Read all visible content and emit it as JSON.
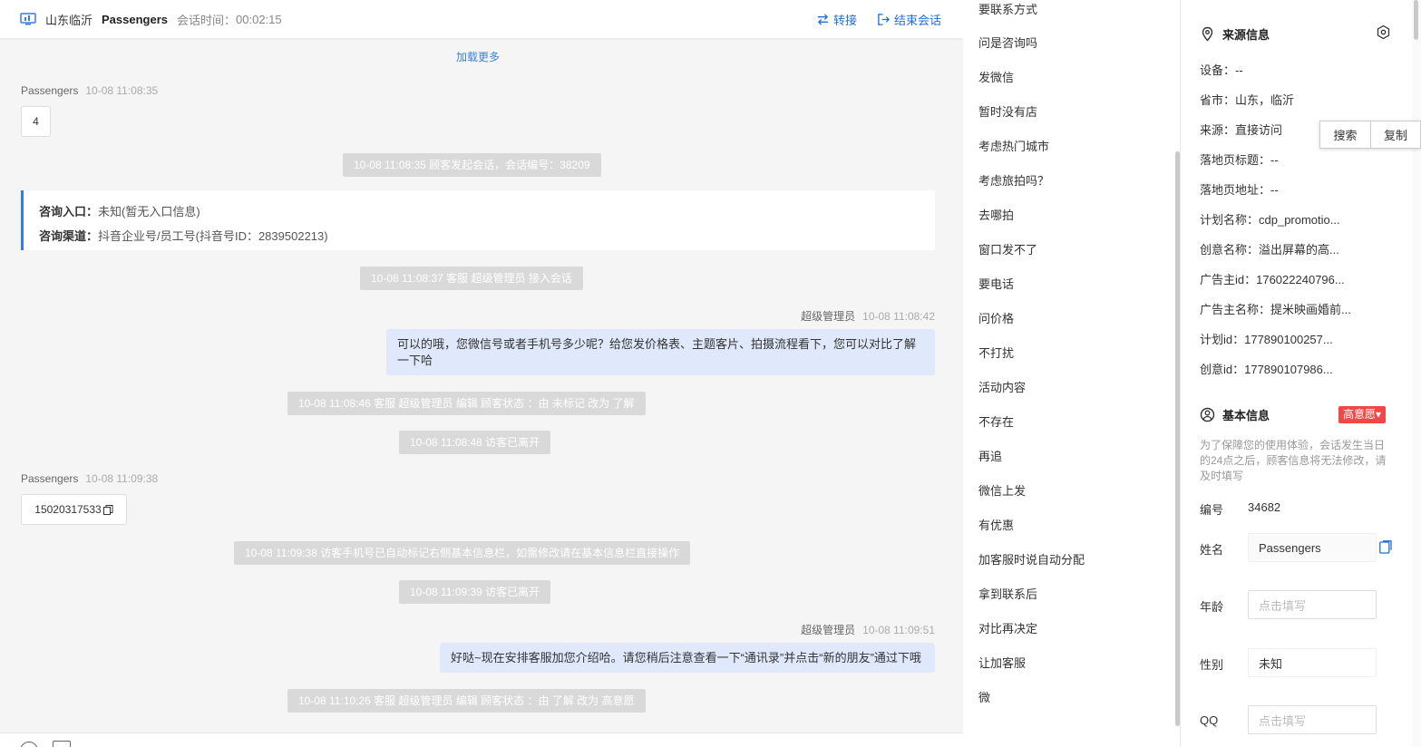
{
  "header": {
    "location": "山东临沂",
    "visitor_name": "Passengers",
    "session_time_label": "会话时间：",
    "session_time": "00:02:15",
    "transfer_label": "转接",
    "end_label": "结束会话"
  },
  "chat": {
    "load_more": "加载更多",
    "msg1": {
      "sender": "Passengers",
      "time": "10-08 11:08:35",
      "text": "4"
    },
    "sys1": "10-08 11:08:35 顾客发起会话，会话编号：38209",
    "card": {
      "entry_label": "咨询入口：",
      "entry_value": "未知(暂无入口信息)",
      "channel_label": "咨询渠道：",
      "channel_value": "抖音企业号/员工号(抖音号ID：2839502213)"
    },
    "sys2": "10-08 11:08:37 客服 超级管理员 接入会话",
    "msg2": {
      "sender": "超级管理员",
      "time": "10-08 11:08:42",
      "text": "可以的哦，您微信号或者手机号多少呢？给您发价格表、主题客片、拍摄流程看下，您可以对比了解一下哈"
    },
    "sys3": "10-08 11:08:46 客服 超级管理员 编辑 顾客状态 ：由 未标记 改为 了解",
    "sys4": "10-08 11:08:48 访客已离开",
    "msg3": {
      "sender": "Passengers",
      "time": "10-08 11:09:38",
      "text": "15020317533"
    },
    "sys5": "10-08 11:09:38 访客手机号已自动标记右侧基本信息栏，如需修改请在基本信息栏直接操作",
    "sys6": "10-08 11:09:39 访客已离开",
    "msg4": {
      "sender": "超级管理员",
      "time": "10-08 11:09:51",
      "text": "好哒~现在安排客服加您介绍哈。请您稍后注意查看一下“通讯录”并点击“新的朋友”通过下哦"
    },
    "sys7": "10-08 11:10:26 客服 超级管理员 编辑 顾客状态 ：由 了解 改为 高意愿"
  },
  "quick_replies": [
    "要联系方式",
    "问是咨询吗",
    "发微信",
    "暂时没有店",
    "考虑热门城市",
    "考虑旅拍吗？",
    "去哪拍",
    "窗口发不了",
    "要电话",
    "问价格",
    "不打扰",
    "活动内容",
    "不存在",
    "再追",
    "微信上发",
    "有优惠",
    "加客服时说自动分配",
    "拿到联系后",
    "对比再决定",
    "让加客服",
    "微"
  ],
  "source": {
    "title": "来源信息",
    "rows": [
      "设备：--",
      "省市：山东，临沂",
      "来源：直接访问",
      "落地页标题：--",
      "落地页地址：--",
      "计划名称：cdp_promotio...",
      "创意名称：溢出屏幕的高...",
      "广告主id：176022240796...",
      "广告主名称：提米映画婚前...",
      "计划id：177890100257...",
      "创意id：177890107986..."
    ]
  },
  "basic": {
    "title": "基本信息",
    "intent_badge": "高意愿▾",
    "note": "为了保障您的使用体验，会话发生当日的24点之后，顾客信息将无法修改，请及时填写",
    "id_label": "编号",
    "id_value": "34682",
    "name_label": "姓名",
    "name_value": "Passengers",
    "age_label": "年龄",
    "age_placeholder": "点击填写",
    "gender_label": "性别",
    "gender_value": "未知",
    "qq_label": "QQ",
    "qq_placeholder": "点击填写"
  },
  "context_menu": {
    "search": "搜索",
    "copy": "复制"
  },
  "colors": {
    "accent": "#1f6fd6",
    "badge": "#f04848",
    "agent_bubble": "#dfe9fb",
    "system_msg": "#d9d9d9"
  }
}
